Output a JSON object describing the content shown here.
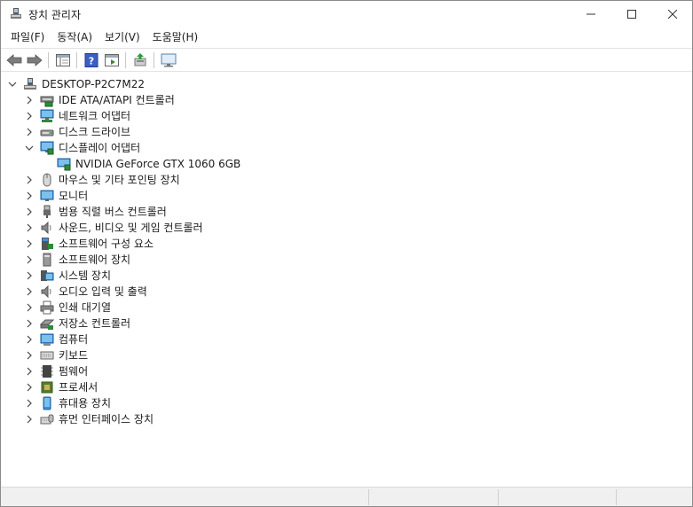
{
  "window": {
    "title": "장치 관리자"
  },
  "menu": [
    "파일(F)",
    "동작(A)",
    "보기(V)",
    "도움말(H)"
  ],
  "toolbar": {
    "buttons": [
      "back-icon",
      "forward-icon",
      "properties-list-icon",
      "help-icon",
      "view-icon",
      "update-driver-icon",
      "monitor-scan-icon"
    ]
  },
  "tree": {
    "root": "DESKTOP-P2C7M22",
    "categories": [
      {
        "label": "IDE ATA/ATAPI 컨트롤러",
        "icon": "ide-controller-icon"
      },
      {
        "label": "네트워크 어댑터",
        "icon": "network-adapter-icon"
      },
      {
        "label": "디스크 드라이브",
        "icon": "disk-drive-icon"
      },
      {
        "label": "디스플레이 어댑터",
        "icon": "display-adapter-icon",
        "expanded": true
      },
      {
        "label": "NVIDIA GeForce GTX 1060 6GB",
        "icon": "gpu-icon",
        "child": true
      },
      {
        "label": "마우스 및 기타 포인팅 장치",
        "icon": "mouse-icon"
      },
      {
        "label": "모니터",
        "icon": "monitor-icon"
      },
      {
        "label": "범용 직렬 버스 컨트롤러",
        "icon": "usb-icon"
      },
      {
        "label": "사운드, 비디오 및 게임 컨트롤러",
        "icon": "sound-icon"
      },
      {
        "label": "소프트웨어 구성 요소",
        "icon": "software-component-icon"
      },
      {
        "label": "소프트웨어 장치",
        "icon": "software-device-icon"
      },
      {
        "label": "시스템 장치",
        "icon": "system-device-icon"
      },
      {
        "label": "오디오 입력 및 출력",
        "icon": "audio-io-icon"
      },
      {
        "label": "인쇄 대기열",
        "icon": "print-queue-icon"
      },
      {
        "label": "저장소 컨트롤러",
        "icon": "storage-controller-icon"
      },
      {
        "label": "컴퓨터",
        "icon": "computer-icon"
      },
      {
        "label": "키보드",
        "icon": "keyboard-icon"
      },
      {
        "label": "펌웨어",
        "icon": "firmware-icon"
      },
      {
        "label": "프로세서",
        "icon": "processor-icon"
      },
      {
        "label": "휴대용 장치",
        "icon": "portable-device-icon"
      },
      {
        "label": "휴먼 인터페이스 장치",
        "icon": "hid-icon"
      }
    ]
  }
}
